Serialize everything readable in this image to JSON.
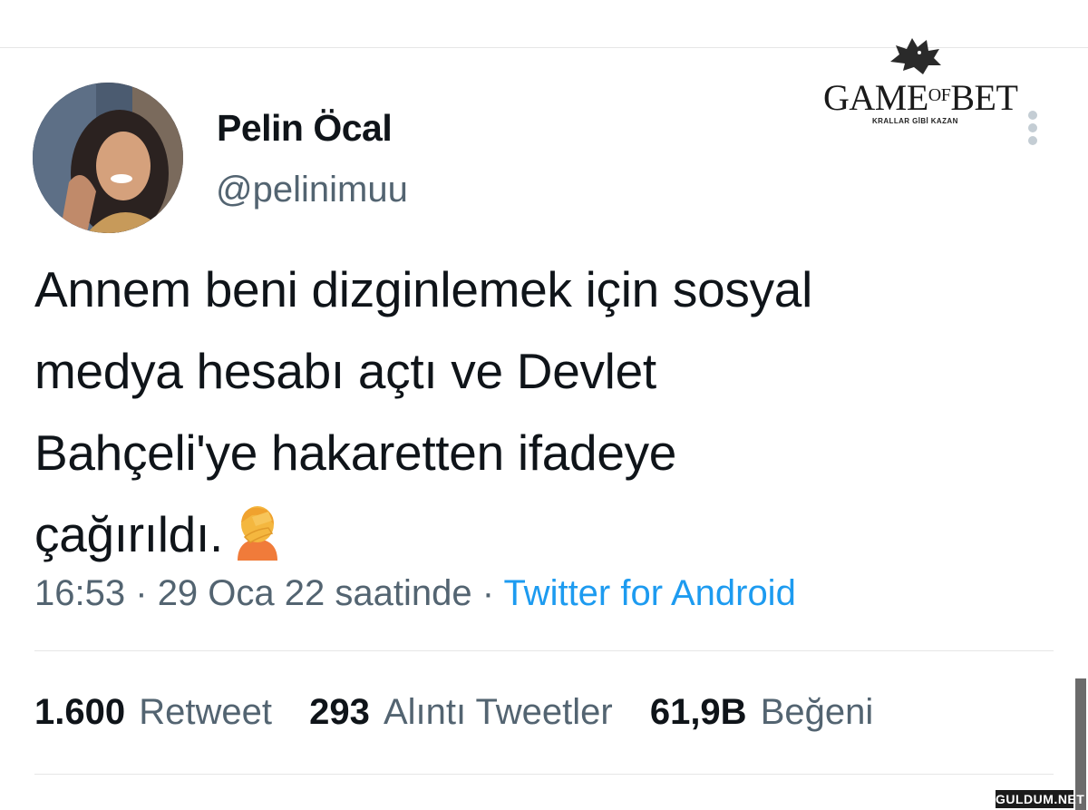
{
  "author": {
    "display_name": "Pelin Öcal",
    "username": "@pelinimuu"
  },
  "brand": {
    "title_left": "GAME",
    "title_of": "OF",
    "title_right": "BET",
    "tagline": "KRALLAR GİBİ KAZAN"
  },
  "tweet": {
    "lines": [
      "Annem beni dizginlemek için sosyal",
      "medya hesabı açtı ve Devlet",
      "Bahçeli'ye hakaretten ifadeye",
      "çağırıldı."
    ],
    "emoji": "facepalm-emoji"
  },
  "meta": {
    "time": "16:53",
    "sep1": "·",
    "date": "29 Oca 22 saatinde",
    "sep2": "·",
    "source": "Twitter for Android"
  },
  "stats": [
    {
      "count": "1.600",
      "label": "Retweet"
    },
    {
      "count": "293",
      "label": "Alıntı Tweetler"
    },
    {
      "count": "61,9B",
      "label": "Beğeni"
    }
  ],
  "watermark": "GULDUM.NET",
  "colors": {
    "text": "#0f1419",
    "secondary": "#536471",
    "link": "#1d9bf0",
    "divider": "#e6e6e6"
  }
}
